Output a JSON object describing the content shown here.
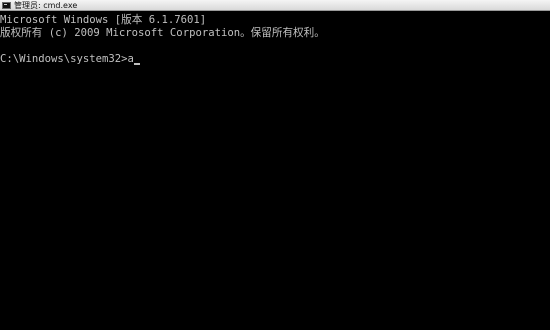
{
  "window": {
    "title": "管理员: cmd.exe",
    "icon": "cmd-icon"
  },
  "console": {
    "lines": [
      "Microsoft Windows [版本 6.1.7601]",
      "版权所有 (c) 2009 Microsoft Corporation。保留所有权利。",
      "",
      "C:\\Windows\\system32>a"
    ]
  },
  "colors": {
    "background": "#000000",
    "text": "#c0c0c0",
    "titlebar": "#e6e6e6"
  }
}
